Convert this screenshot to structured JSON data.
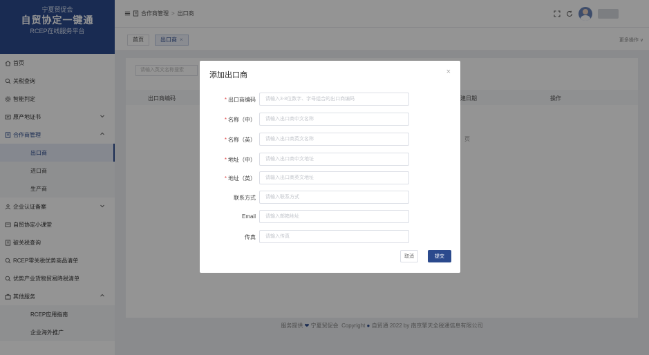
{
  "brand": {
    "org": "宁夏贸促会",
    "title": "自贸协定一键通",
    "subtitle": "RCEP在线服务平台"
  },
  "sidebar": {
    "items": [
      {
        "label": "首页",
        "icon": "home-icon"
      },
      {
        "label": "关税查询",
        "icon": "search-icon"
      },
      {
        "label": "智能判定",
        "icon": "gear-icon"
      },
      {
        "label": "原产地证书",
        "icon": "certificate-icon",
        "expandable": true
      },
      {
        "label": "合作商管理",
        "icon": "partner-icon",
        "expandable": true,
        "open": true,
        "children": [
          {
            "label": "出口商",
            "active": true
          },
          {
            "label": "进口商"
          },
          {
            "label": "生产商"
          }
        ]
      },
      {
        "label": "企业认证备案",
        "icon": "enterprise-icon",
        "expandable": true
      },
      {
        "label": "自贸协定小课堂",
        "icon": "classroom-icon"
      },
      {
        "label": "破关税查询",
        "icon": "document-icon"
      },
      {
        "label": "RCEP零关税优势商品清单",
        "icon": "search-icon"
      },
      {
        "label": "优势产业货物贸易降税清单",
        "icon": "search-icon"
      },
      {
        "label": "其他服务",
        "icon": "service-icon",
        "expandable": true,
        "open": true,
        "children": [
          {
            "label": "RCEP应用指南"
          },
          {
            "label": "企业海外推广"
          }
        ]
      }
    ]
  },
  "header": {
    "breadcrumb": [
      "合作商管理",
      "出口商"
    ]
  },
  "tabs": {
    "home": "首页",
    "active": "出口商",
    "close": "×",
    "more": "更多操作 ∨"
  },
  "page": {
    "search_placeholder": "请输入英文名称搜索",
    "columns": {
      "code": "出口商编码",
      "created": "创建日期",
      "action": "操作"
    },
    "nodata": "页"
  },
  "footer": {
    "text_before": "服务提供",
    "org": "宁夏贸促会",
    "text_after": "Copyright",
    "copyright": "自贸通 2022 by 南京擎天全税通信息有限公司"
  },
  "modal": {
    "title": "添加出口商",
    "close": "×",
    "fields": [
      {
        "label": "出口商编码",
        "required": true,
        "placeholder": "请输入3-8位数字、字母组合的出口商编码",
        "value": ""
      },
      {
        "label": "名称（中）",
        "required": true,
        "placeholder": "请输入出口商中文名称",
        "value": ""
      },
      {
        "label": "名称（英）",
        "required": true,
        "placeholder": "请输入出口商英文名称",
        "value": ""
      },
      {
        "label": "地址（中）",
        "required": true,
        "placeholder": "请输入出口商中文地址",
        "value": ""
      },
      {
        "label": "地址（英）",
        "required": true,
        "placeholder": "请输入出口商英文地址",
        "value": ""
      },
      {
        "label": "联系方式",
        "required": false,
        "placeholder": "请输入联系方式",
        "value": ""
      },
      {
        "label": "Email",
        "required": false,
        "placeholder": "请输入邮箱地址",
        "value": ""
      },
      {
        "label": "传真",
        "required": false,
        "placeholder": "请输入传真",
        "value": ""
      }
    ],
    "cancel_label": "取消",
    "submit_label": "提交"
  },
  "colors": {
    "primary": "#2b4a8d",
    "required": "#e04a4a"
  }
}
